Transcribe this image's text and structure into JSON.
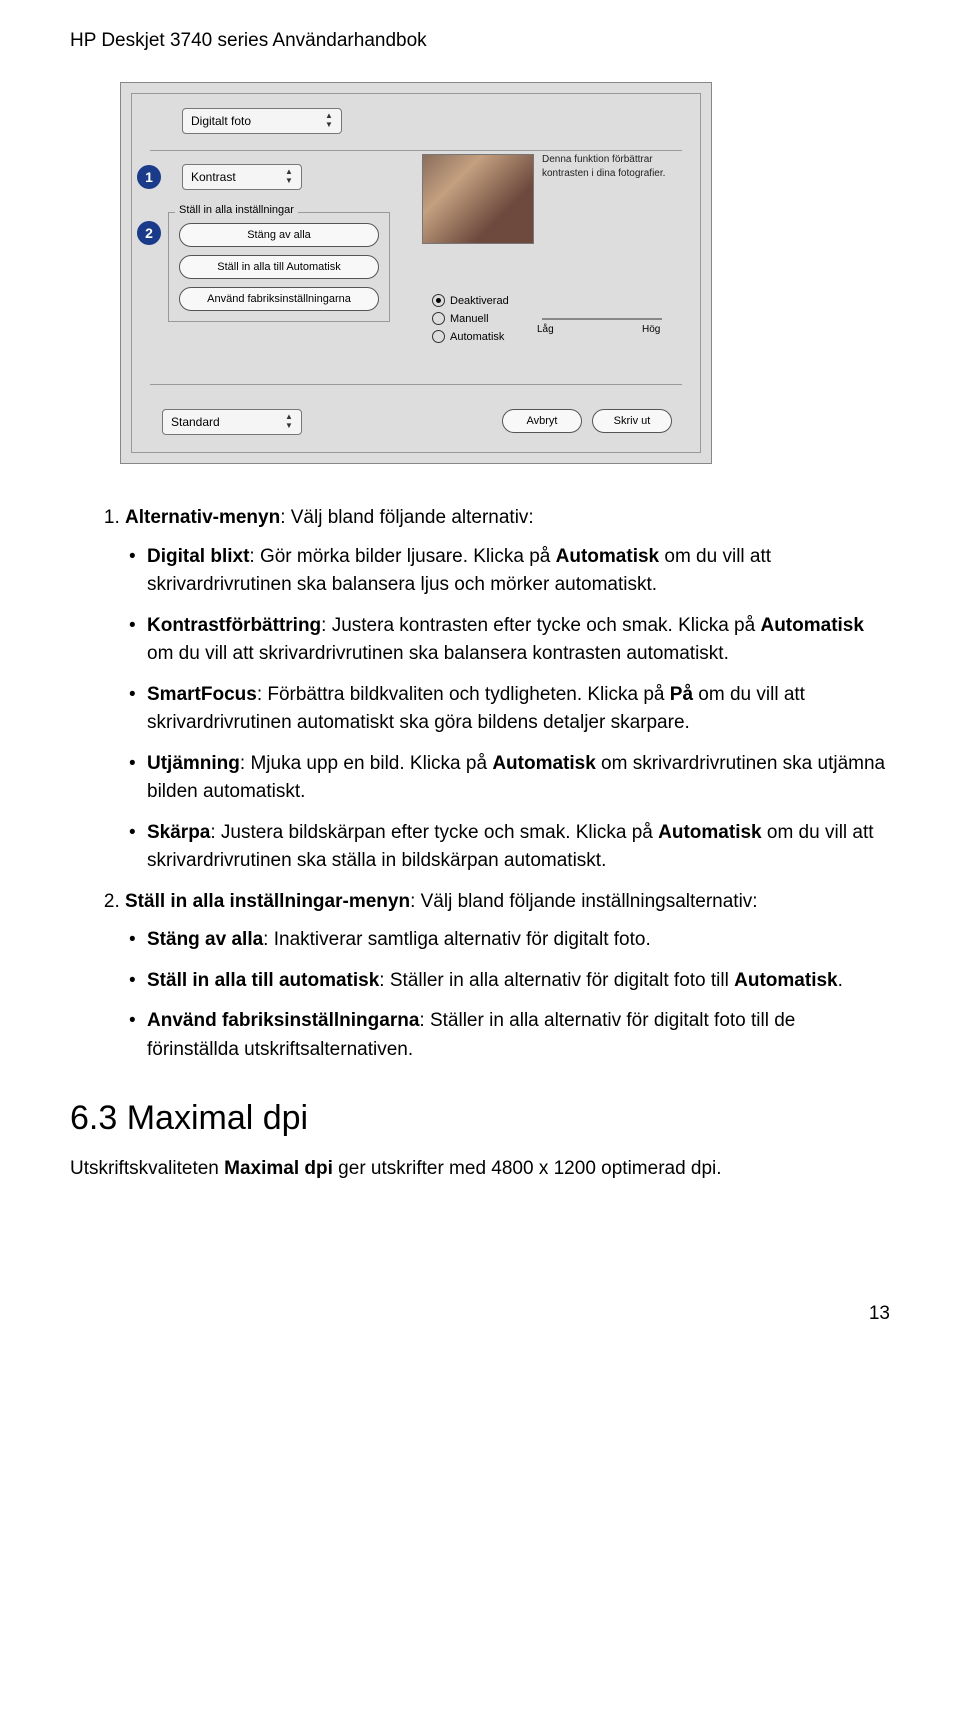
{
  "header": "HP Deskjet 3740 series Användarhandbok",
  "callouts": {
    "c1": "1",
    "c2": "2"
  },
  "dialog": {
    "top_dropdown": "Digitalt foto",
    "kontrast_dropdown": "Kontrast",
    "preview_hint_1": "Denna funktion förbättrar",
    "preview_hint_2": "kontrasten i dina fotografier.",
    "group_label": "Ställ in alla inställningar",
    "btn_stang": "Stäng av alla",
    "btn_auto": "Ställ in alla till Automatisk",
    "btn_fabrik": "Använd fabriksinställningarna",
    "radio_deakt": "Deaktiverad",
    "radio_manuell": "Manuell",
    "radio_auto": "Automatisk",
    "slider_low": "Låg",
    "slider_high": "Hög",
    "bottom_standard": "Standard",
    "btn_avbryt": "Avbryt",
    "btn_skrivut": "Skriv ut"
  },
  "list1": {
    "intro_b": "Alternativ-menyn",
    "intro_rest": ": Välj bland följande alternativ:",
    "i1_b": "Digital blixt",
    "i1_rest": ": Gör mörka bilder ljusare. Klicka på ",
    "i1_b2": "Automatisk",
    "i1_tail": " om du vill att skrivardrivrutinen ska balansera ljus och mörker automatiskt.",
    "i2_b": "Kontrastförbättring",
    "i2_rest": ": Justera kontrasten efter tycke och smak. Klicka på ",
    "i2_b2": "Automatisk",
    "i2_tail": " om du vill att skrivardrivrutinen ska balansera kontrasten automatiskt.",
    "i3_b": "SmartFocus",
    "i3_rest": ": Förbättra bildkvaliten och tydligheten. Klicka på ",
    "i3_b2": "På",
    "i3_tail": " om du vill att skrivardrivrutinen automatiskt ska göra bildens detaljer skarpare.",
    "i4_b": "Utjämning",
    "i4_rest": ": Mjuka upp en bild. Klicka på ",
    "i4_b2": "Automatisk",
    "i4_tail": " om skrivardrivrutinen ska utjämna bilden automatiskt.",
    "i5_b": "Skärpa",
    "i5_rest": ": Justera bildskärpan efter tycke och smak. Klicka på ",
    "i5_b2": "Automatisk",
    "i5_tail": " om du vill att skrivardrivrutinen ska ställa in bildskärpan automatiskt."
  },
  "list2": {
    "intro_b": "Ställ in alla inställningar-menyn",
    "intro_rest": ": Välj bland följande inställningsalternativ:",
    "i1_b": "Stäng av alla",
    "i1_rest": ": Inaktiverar samtliga alternativ för digitalt foto.",
    "i2_b": "Ställ in alla till automatisk",
    "i2_rest": ": Ställer in alla alternativ för digitalt foto till ",
    "i2_b2": "Automatisk",
    "i2_tail": ".",
    "i3_b": "Använd fabriksinställningarna",
    "i3_rest": ": Ställer in alla alternativ för digitalt foto till de förinställda utskriftsalternativen."
  },
  "section_heading": "6.3  Maximal dpi",
  "section_para_a": "Utskriftskvaliteten ",
  "section_para_b": "Maximal dpi",
  "section_para_c": " ger utskrifter med 4800 x 1200 optimerad dpi.",
  "page_number": "13"
}
